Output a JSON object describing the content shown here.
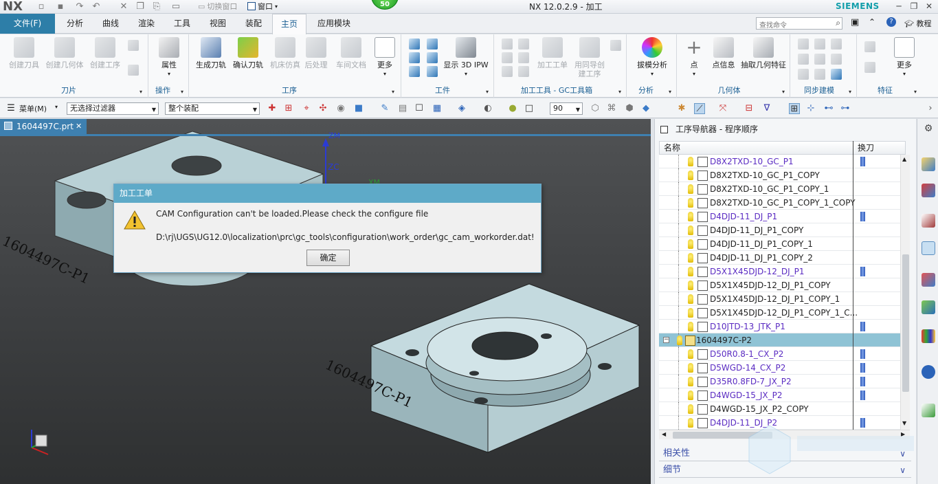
{
  "titlebar": {
    "logo": "NX",
    "switch_window": "切换窗口",
    "window_menu": "窗口",
    "badge": "50",
    "title": "NX 12.0.2.9 - 加工",
    "brand": "SIEMENS"
  },
  "menubar": {
    "file": "文件(F)",
    "tabs": [
      "分析",
      "曲线",
      "渲染",
      "工具",
      "视图",
      "装配",
      "主页",
      "应用模块"
    ],
    "active_tab": "主页",
    "search_placeholder": "查找命令",
    "tutorial": "教程"
  },
  "ribbon": {
    "groups": {
      "tool": {
        "label": "刀片",
        "buttons": [
          "创建刀具",
          "创建几何体",
          "创建工序"
        ]
      },
      "operation": {
        "label": "操作",
        "buttons": [
          "属性"
        ]
      },
      "process": {
        "label": "工序",
        "buttons": [
          "生成刀轨",
          "确认刀轨",
          "机床仿真",
          "后处理",
          "车间文档",
          "更多"
        ]
      },
      "workpiece": {
        "label": "工件",
        "buttons": [
          "显示 3D IPW"
        ]
      },
      "gc": {
        "label": "加工工具 - GC工具箱",
        "buttons": [
          "加工工单",
          "用同导创建工序"
        ]
      },
      "analysis": {
        "label": "分析",
        "buttons": [
          "拔模分析"
        ]
      },
      "geometry": {
        "label": "几何体",
        "buttons": [
          "点",
          "点信息",
          "抽取几何特征"
        ]
      },
      "sync": {
        "label": "同步建模"
      },
      "feature": {
        "label": "特征",
        "buttons": [
          "更多"
        ]
      }
    }
  },
  "toolbar": {
    "menu": "菜单(M)",
    "filter": "无选择过滤器",
    "scope": "整个装配",
    "angle": "90"
  },
  "viewport": {
    "file_tab": "1604497C.prt",
    "axis_zm": "ZM",
    "axis_zc": "ZC",
    "axis_xm": "XM",
    "part_label_1": "1604497C-P1",
    "part_label_2": "1604497C-P1"
  },
  "dialog": {
    "title": "加工工单",
    "message": "CAM Configuration can't be loaded.Please check the configure file",
    "path": "D:\\rj\\UGS\\UG12.0\\localization\\prc\\gc_tools\\configuration\\work_order\\gc_cam_workorder.dat!",
    "ok": "确定"
  },
  "navigator": {
    "title": "工序导航器 - 程序顺序",
    "col_name": "名称",
    "col_tool": "换刀",
    "rows": [
      {
        "name": "D8X2TXD-10_GC_P1",
        "type": "mod",
        "tool": true
      },
      {
        "name": "D8X2TXD-10_GC_P1_COPY",
        "type": "op",
        "tool": false
      },
      {
        "name": "D8X2TXD-10_GC_P1_COPY_1",
        "type": "op",
        "tool": false
      },
      {
        "name": "D8X2TXD-10_GC_P1_COPY_1_COPY",
        "type": "op",
        "tool": false
      },
      {
        "name": "D4DJD-11_DJ_P1",
        "type": "mod",
        "tool": true
      },
      {
        "name": "D4DJD-11_DJ_P1_COPY",
        "type": "op",
        "tool": false
      },
      {
        "name": "D4DJD-11_DJ_P1_COPY_1",
        "type": "op",
        "tool": false
      },
      {
        "name": "D4DJD-11_DJ_P1_COPY_2",
        "type": "op",
        "tool": false
      },
      {
        "name": "D5X1X45DJD-12_DJ_P1",
        "type": "mod",
        "tool": true
      },
      {
        "name": "D5X1X45DJD-12_DJ_P1_COPY",
        "type": "op",
        "tool": false
      },
      {
        "name": "D5X1X45DJD-12_DJ_P1_COPY_1",
        "type": "op",
        "tool": false
      },
      {
        "name": "D5X1X45DJD-12_DJ_P1_COPY_1_C...",
        "type": "op",
        "tool": false
      },
      {
        "name": "D10JTD-13_JTK_P1",
        "type": "mod",
        "tool": true
      },
      {
        "name": "1604497C-P2",
        "type": "grp",
        "tool": false
      },
      {
        "name": "D50R0.8-1_CX_P2",
        "type": "mod",
        "tool": true
      },
      {
        "name": "D5WGD-14_CX_P2",
        "type": "mod",
        "tool": true
      },
      {
        "name": "D35R0.8FD-7_JX_P2",
        "type": "mod",
        "tool": true
      },
      {
        "name": "D4WGD-15_JX_P2",
        "type": "mod",
        "tool": true
      },
      {
        "name": "D4WGD-15_JX_P2_COPY",
        "type": "op",
        "tool": false
      },
      {
        "name": "D4DJD-11_DJ_P2",
        "type": "mod",
        "tool": true
      }
    ],
    "section_dependencies": "相关性",
    "section_details": "细节"
  },
  "colors": {
    "accent": "#2d7ea8",
    "dialog_title": "#5eaac8",
    "modified_op": "#5a2bc2",
    "selected_row": "#8fc3d5"
  }
}
